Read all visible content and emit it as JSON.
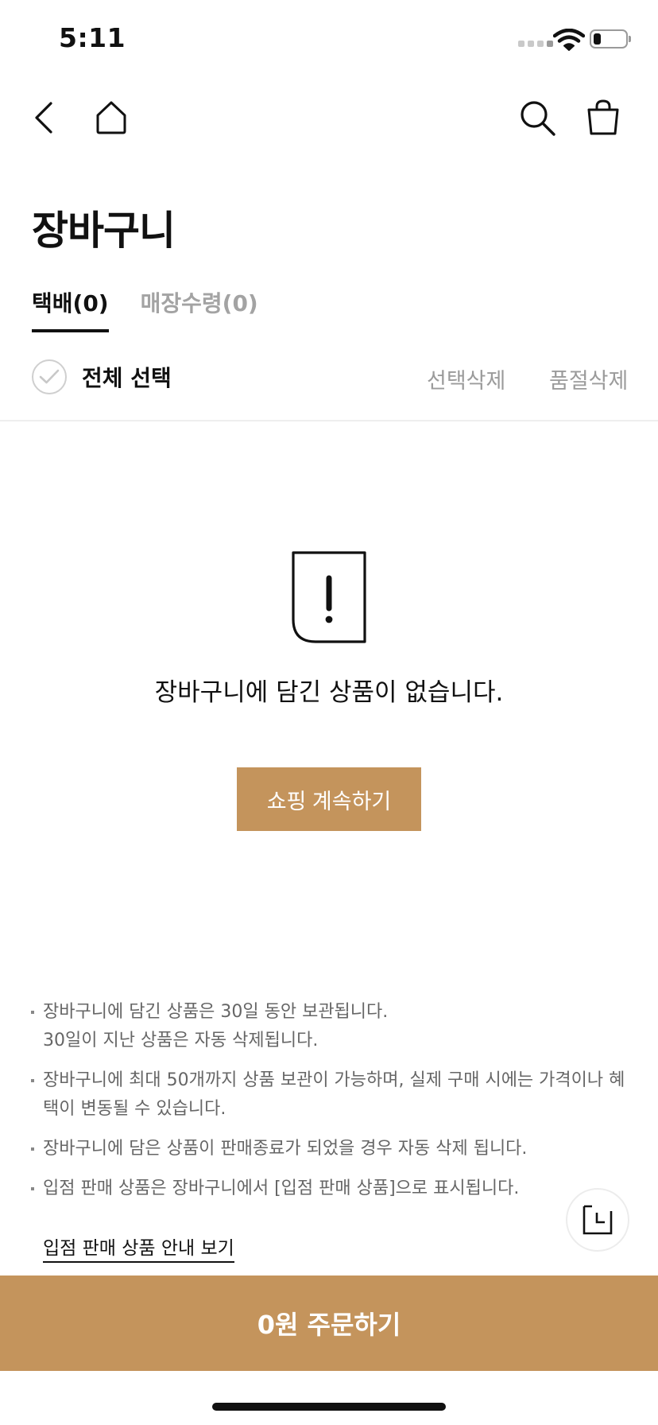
{
  "status_bar": {
    "time": "5:11",
    "battery_level": 0.2
  },
  "nav": {
    "back_icon": "chevron-left-icon",
    "home_icon": "home-icon",
    "search_icon": "search-icon",
    "cart_icon": "shopping-bag-icon"
  },
  "page": {
    "title": "장바구니"
  },
  "tabs": [
    {
      "label": "택배(0)",
      "active": true
    },
    {
      "label": "매장수령(0)",
      "active": false
    }
  ],
  "selection": {
    "select_all": "전체 선택",
    "delete_selected": "선택삭제",
    "delete_soldout": "품절삭제"
  },
  "empty_state": {
    "icon": "exclamation-icon",
    "message": "장바구니에 담긴 상품이 없습니다.",
    "button": "쇼핑 계속하기"
  },
  "notices": [
    {
      "lines": [
        "장바구니에 담긴 상품은 30일 동안 보관됩니다.",
        "30일이 지난 상품은 자동 삭제됩니다."
      ]
    },
    {
      "lines": [
        "장바구니에 최대 50개까지 상품 보관이 가능하며, 실제 구매 시에는 가격이나 혜",
        "택이 변동될 수 있습니다."
      ]
    },
    {
      "lines": [
        "장바구니에 담은 상품이 판매종료가 되었을 경우 자동 삭제 됩니다."
      ]
    },
    {
      "lines": [
        "입점 판매 상품은 장바구니에서 [입점 판매 상품]으로 표시됩니다."
      ]
    }
  ],
  "guide_link": "입점 판매 상품 안내 보기",
  "order_button": "0원 주문하기",
  "colors": {
    "accent": "#c4945c",
    "text": "#111111",
    "muted": "#9b9b9b"
  }
}
